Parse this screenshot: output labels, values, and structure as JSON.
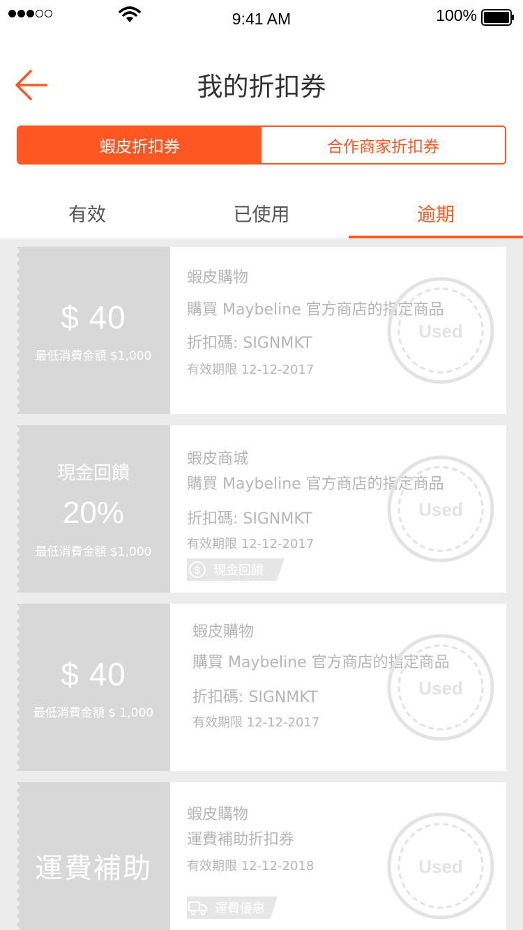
{
  "status_bar": {
    "time": "9:41 AM",
    "battery": "100%"
  },
  "nav": {
    "title": "我的折扣券"
  },
  "segments": [
    "蝦皮折扣券",
    "合作商家折扣券"
  ],
  "tabs": [
    "有效",
    "已使用",
    "逾期"
  ],
  "coupons": [
    {
      "amount": "$ 40",
      "min_spend": "最低消費金額 $1,000",
      "shop": "蝦皮購物",
      "desc": "購買 Maybeline 官方商店的指定商品",
      "code": "折扣碼: SIGNMKT",
      "expiry": "有效期限 12-12-2017",
      "stamp": "Used"
    },
    {
      "label": "現金回饋",
      "percent": "20%",
      "min_spend": "最低消費金額 $1,000",
      "shop": "蝦皮商城",
      "desc": "購買 Maybeline 官方商店的指定商品",
      "code": "折扣碼: SIGNMKT",
      "expiry": "有效期限 12-12-2017",
      "badge": "現金回饋",
      "stamp": "Used"
    },
    {
      "amount": "$ 40",
      "min_spend": "最低消費金額 $ 1,000",
      "shop": "蝦皮購物",
      "desc": "購買 Maybeline 官方商店的指定商品",
      "code": "折扣碼: SIGNMKT",
      "expiry": "有效期限 12-12-2017",
      "stamp": "Used"
    },
    {
      "label": "運費補助",
      "shop": "蝦皮購物",
      "desc": "運費補助折扣券",
      "expiry": "有效期限 12-12-2018",
      "badge": "運費優惠",
      "stamp": "Used"
    }
  ],
  "colors": {
    "accent": "#ff5722",
    "coupon_left": "#d8d8d8",
    "list_bg": "#ececec"
  },
  "icons": [
    "signal-dots-icon",
    "wifi-icon",
    "battery-icon",
    "back-arrow-icon",
    "used-stamp-icon",
    "dollar-circle-icon",
    "truck-icon"
  ]
}
